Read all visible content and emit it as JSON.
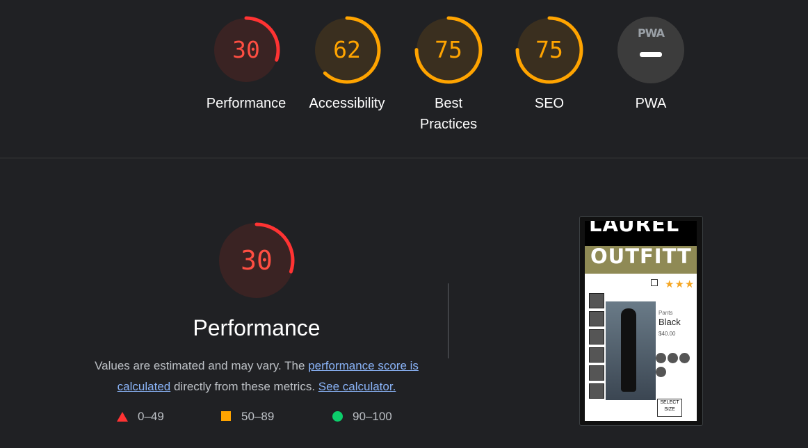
{
  "categories": [
    {
      "label": "Performance",
      "score": "30",
      "value": 0.3,
      "color": "#ff3333",
      "text_color": "#ff4e42",
      "bg": "#3a2323"
    },
    {
      "label": "Accessibility",
      "score": "62",
      "value": 0.62,
      "color": "#ffa400",
      "text_color": "#ffa400",
      "bg": "#3a2f1f"
    },
    {
      "label": "Best Practices",
      "score": "75",
      "value": 0.75,
      "color": "#ffa400",
      "text_color": "#ffa400",
      "bg": "#3a2f1f"
    },
    {
      "label": "SEO",
      "score": "75",
      "value": 0.75,
      "color": "#ffa400",
      "text_color": "#ffa400",
      "bg": "#3a2f1f"
    }
  ],
  "pwa": {
    "label": "PWA",
    "badge_text": "PWA",
    "icon": "pwa-badge-icon"
  },
  "performance": {
    "score": "30",
    "value": 0.3,
    "title": "Performance",
    "desc_prefix": "Values are estimated and may vary. The ",
    "link_score": "performance score is calculated",
    "desc_mid": " directly from these metrics. ",
    "link_calc": "See calculator."
  },
  "legend": [
    {
      "icon": "fail-triangle-icon",
      "range": "0–49",
      "color": "#ff3333"
    },
    {
      "icon": "average-square-icon",
      "range": "50–89",
      "color": "#ffa400"
    },
    {
      "icon": "pass-circle-icon",
      "range": "90–100",
      "color": "#0cce6b"
    }
  ],
  "screenshot": {
    "brand_line1": "LAUREL",
    "brand_line2": "OUTFITT",
    "product_type": "Pants",
    "product_name": "Black",
    "product_price": "$40.00",
    "select_size": "SELECT SIZE"
  }
}
